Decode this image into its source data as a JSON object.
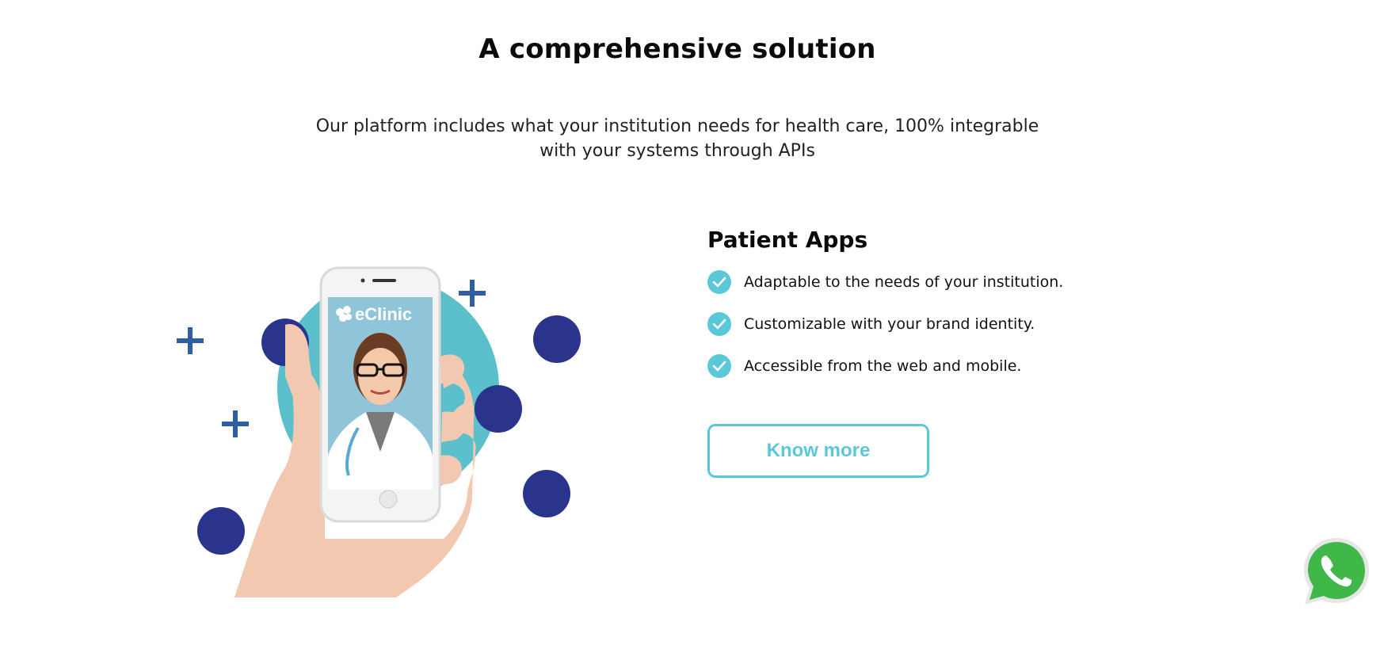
{
  "section": {
    "title": "A comprehensive solution",
    "intro_line1": "Our platform includes what your institution needs for health care, 100% integrable",
    "intro_line2": "with your systems through APIs"
  },
  "illustration": {
    "app_brand": "eClinic",
    "colors": {
      "teal_circle": "#5bbfcc",
      "navy_dots": "#2b348c",
      "plus_signs": "#2f5ea5"
    }
  },
  "feature": {
    "title": "Patient Apps",
    "items": [
      "Adaptable to the needs of your institution.",
      "Customizable with your brand identity.",
      "Accessible from the web and mobile."
    ],
    "button_label": "Know more"
  },
  "colors": {
    "accent": "#5bc8da",
    "whatsapp_green": "#3fb849"
  },
  "icons": {
    "check": "check-icon",
    "whatsapp": "whatsapp-icon"
  }
}
